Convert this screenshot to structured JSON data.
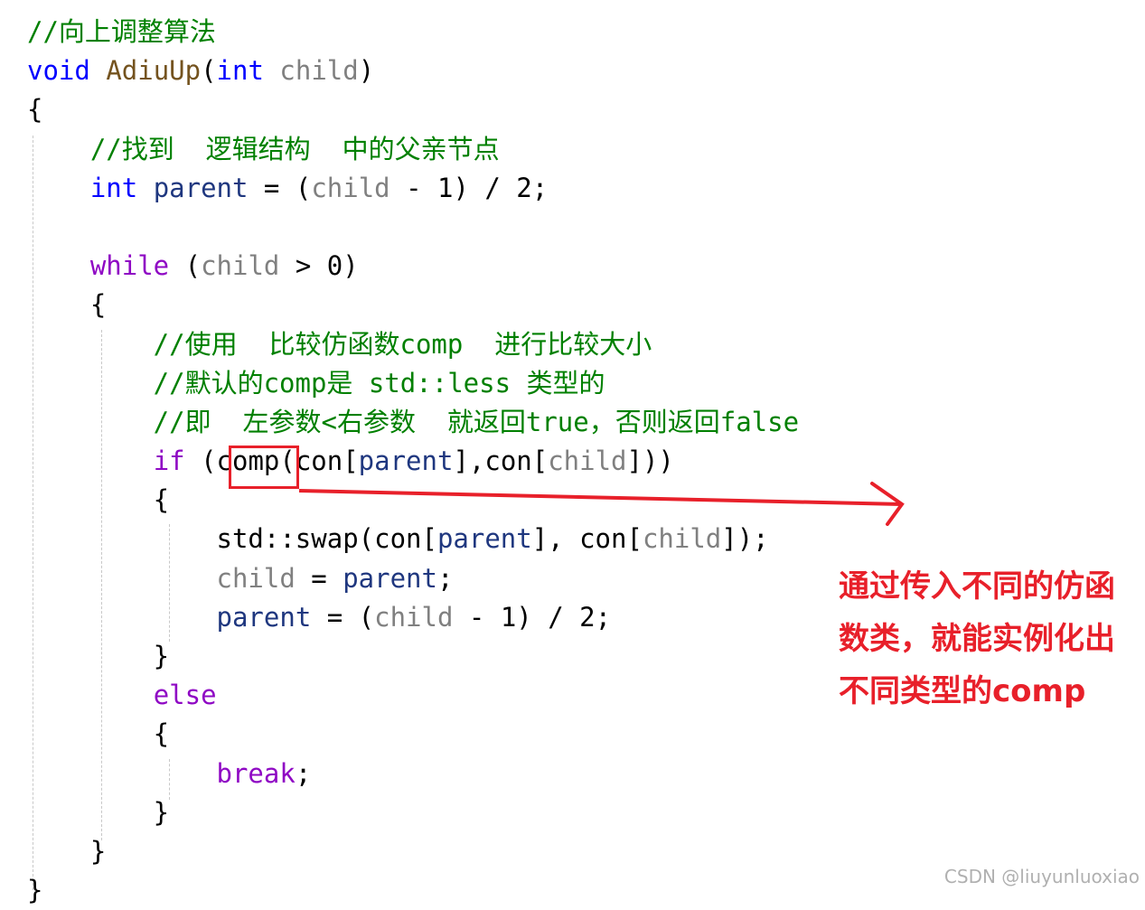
{
  "code": {
    "lines": [
      [
        {
          "t": "//向上调整算法",
          "c": "cmt"
        }
      ],
      [
        {
          "t": "void",
          "c": "kw"
        },
        {
          "t": " ",
          "c": ""
        },
        {
          "t": "AdiuUp",
          "c": "fn"
        },
        {
          "t": "(",
          "c": ""
        },
        {
          "t": "int",
          "c": "kw"
        },
        {
          "t": " ",
          "c": ""
        },
        {
          "t": "child",
          "c": "param"
        },
        {
          "t": ")",
          "c": ""
        }
      ],
      [
        {
          "t": "{",
          "c": ""
        }
      ],
      [
        {
          "t": "    //找到  逻辑结构  中的父亲节点",
          "c": "cmt"
        }
      ],
      [
        {
          "t": "    ",
          "c": ""
        },
        {
          "t": "int",
          "c": "kw"
        },
        {
          "t": " ",
          "c": ""
        },
        {
          "t": "parent",
          "c": "var"
        },
        {
          "t": " = (",
          "c": ""
        },
        {
          "t": "child",
          "c": "param"
        },
        {
          "t": " - 1) / 2;",
          "c": ""
        }
      ],
      [
        {
          "t": "",
          "c": ""
        }
      ],
      [
        {
          "t": "    ",
          "c": ""
        },
        {
          "t": "while",
          "c": "ctl"
        },
        {
          "t": " (",
          "c": ""
        },
        {
          "t": "child",
          "c": "param"
        },
        {
          "t": " > 0)",
          "c": ""
        }
      ],
      [
        {
          "t": "    {",
          "c": ""
        }
      ],
      [
        {
          "t": "        //使用  比较仿函数comp  进行比较大小",
          "c": "cmt"
        }
      ],
      [
        {
          "t": "        //默认的comp是 std::less 类型的",
          "c": "cmt"
        }
      ],
      [
        {
          "t": "        //即  左参数<右参数  就返回true，否则返回false",
          "c": "cmt"
        }
      ],
      [
        {
          "t": "        ",
          "c": ""
        },
        {
          "t": "if",
          "c": "ctl"
        },
        {
          "t": " (comp(con[",
          "c": ""
        },
        {
          "t": "parent",
          "c": "var"
        },
        {
          "t": "],con[",
          "c": ""
        },
        {
          "t": "child",
          "c": "param"
        },
        {
          "t": "]))",
          "c": ""
        }
      ],
      [
        {
          "t": "        {",
          "c": ""
        }
      ],
      [
        {
          "t": "            std::swap(con[",
          "c": ""
        },
        {
          "t": "parent",
          "c": "var"
        },
        {
          "t": "], con[",
          "c": ""
        },
        {
          "t": "child",
          "c": "param"
        },
        {
          "t": "]);",
          "c": ""
        }
      ],
      [
        {
          "t": "            ",
          "c": ""
        },
        {
          "t": "child",
          "c": "param"
        },
        {
          "t": " = ",
          "c": ""
        },
        {
          "t": "parent",
          "c": "var"
        },
        {
          "t": ";",
          "c": ""
        }
      ],
      [
        {
          "t": "            ",
          "c": ""
        },
        {
          "t": "parent",
          "c": "var"
        },
        {
          "t": " = (",
          "c": ""
        },
        {
          "t": "child",
          "c": "param"
        },
        {
          "t": " - 1) / 2;",
          "c": ""
        }
      ],
      [
        {
          "t": "        }",
          "c": ""
        }
      ],
      [
        {
          "t": "        ",
          "c": ""
        },
        {
          "t": "else",
          "c": "ctl"
        }
      ],
      [
        {
          "t": "        {",
          "c": ""
        }
      ],
      [
        {
          "t": "            ",
          "c": ""
        },
        {
          "t": "break",
          "c": "ctl"
        },
        {
          "t": ";",
          "c": ""
        }
      ],
      [
        {
          "t": "        }",
          "c": ""
        }
      ],
      [
        {
          "t": "    }",
          "c": ""
        }
      ],
      [
        {
          "t": "}",
          "c": ""
        }
      ]
    ]
  },
  "annotation": {
    "text": "通过传入不同的仿函\n数类，就能实例化出\n不同类型的comp",
    "highlighted_token": "comp",
    "color": "#e8202a"
  },
  "watermark": "CSDN @liuyunluoxiao"
}
